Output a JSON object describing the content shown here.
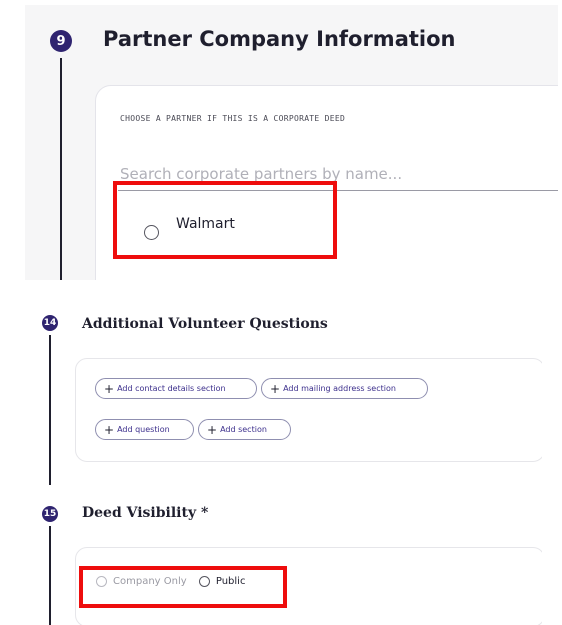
{
  "partner_section": {
    "step_number": "9",
    "title": "Partner Company Information",
    "choose_label": "CHOOSE A PARTNER IF THIS IS A CORPORATE DEED",
    "search_placeholder": "Search corporate partners by name...",
    "partner_option": "Walmart"
  },
  "questions_section": {
    "step_number": "14",
    "title": "Additional Volunteer Questions",
    "buttons": {
      "add_contact": "Add contact details section",
      "add_mailing": "Add mailing address section",
      "add_question": "Add question",
      "add_section": "Add section"
    },
    "plus_icon": "+"
  },
  "visibility_section": {
    "step_number": "15",
    "title": "Deed Visibility *",
    "options": {
      "company_only": "Company Only",
      "public": "Public"
    }
  },
  "colors": {
    "badge": "#2f2470",
    "highlight": "#ee0d0d",
    "pill_text": "#3c2f8c"
  }
}
